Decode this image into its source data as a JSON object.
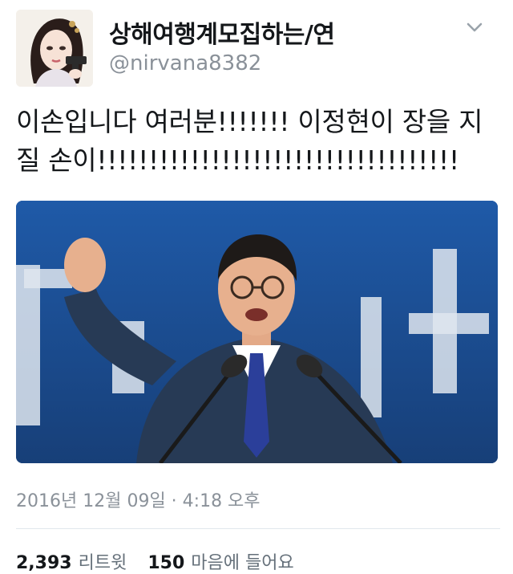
{
  "tweet": {
    "display_name": "상해여행계모집하는/연",
    "handle": "@nirvana8382",
    "text": "이손입니다 여러분!!!!!!! 이정현이 장을 지질 손이!!!!!!!!!!!!!!!!!!!!!!!!!!!!!!!!!!!",
    "timestamp": "2016년 12월 09일 · 4:18 오후",
    "retweets_count": "2,393",
    "retweets_label": "리트윗",
    "likes_count": "150",
    "likes_label": "마음에 들어요"
  },
  "icons": {
    "menu_caret": "chevron-down-icon"
  },
  "colors": {
    "text_primary": "#14171a",
    "text_secondary": "#8a9199",
    "divider": "#e1e8ed",
    "media_background": "#1d4f94"
  }
}
